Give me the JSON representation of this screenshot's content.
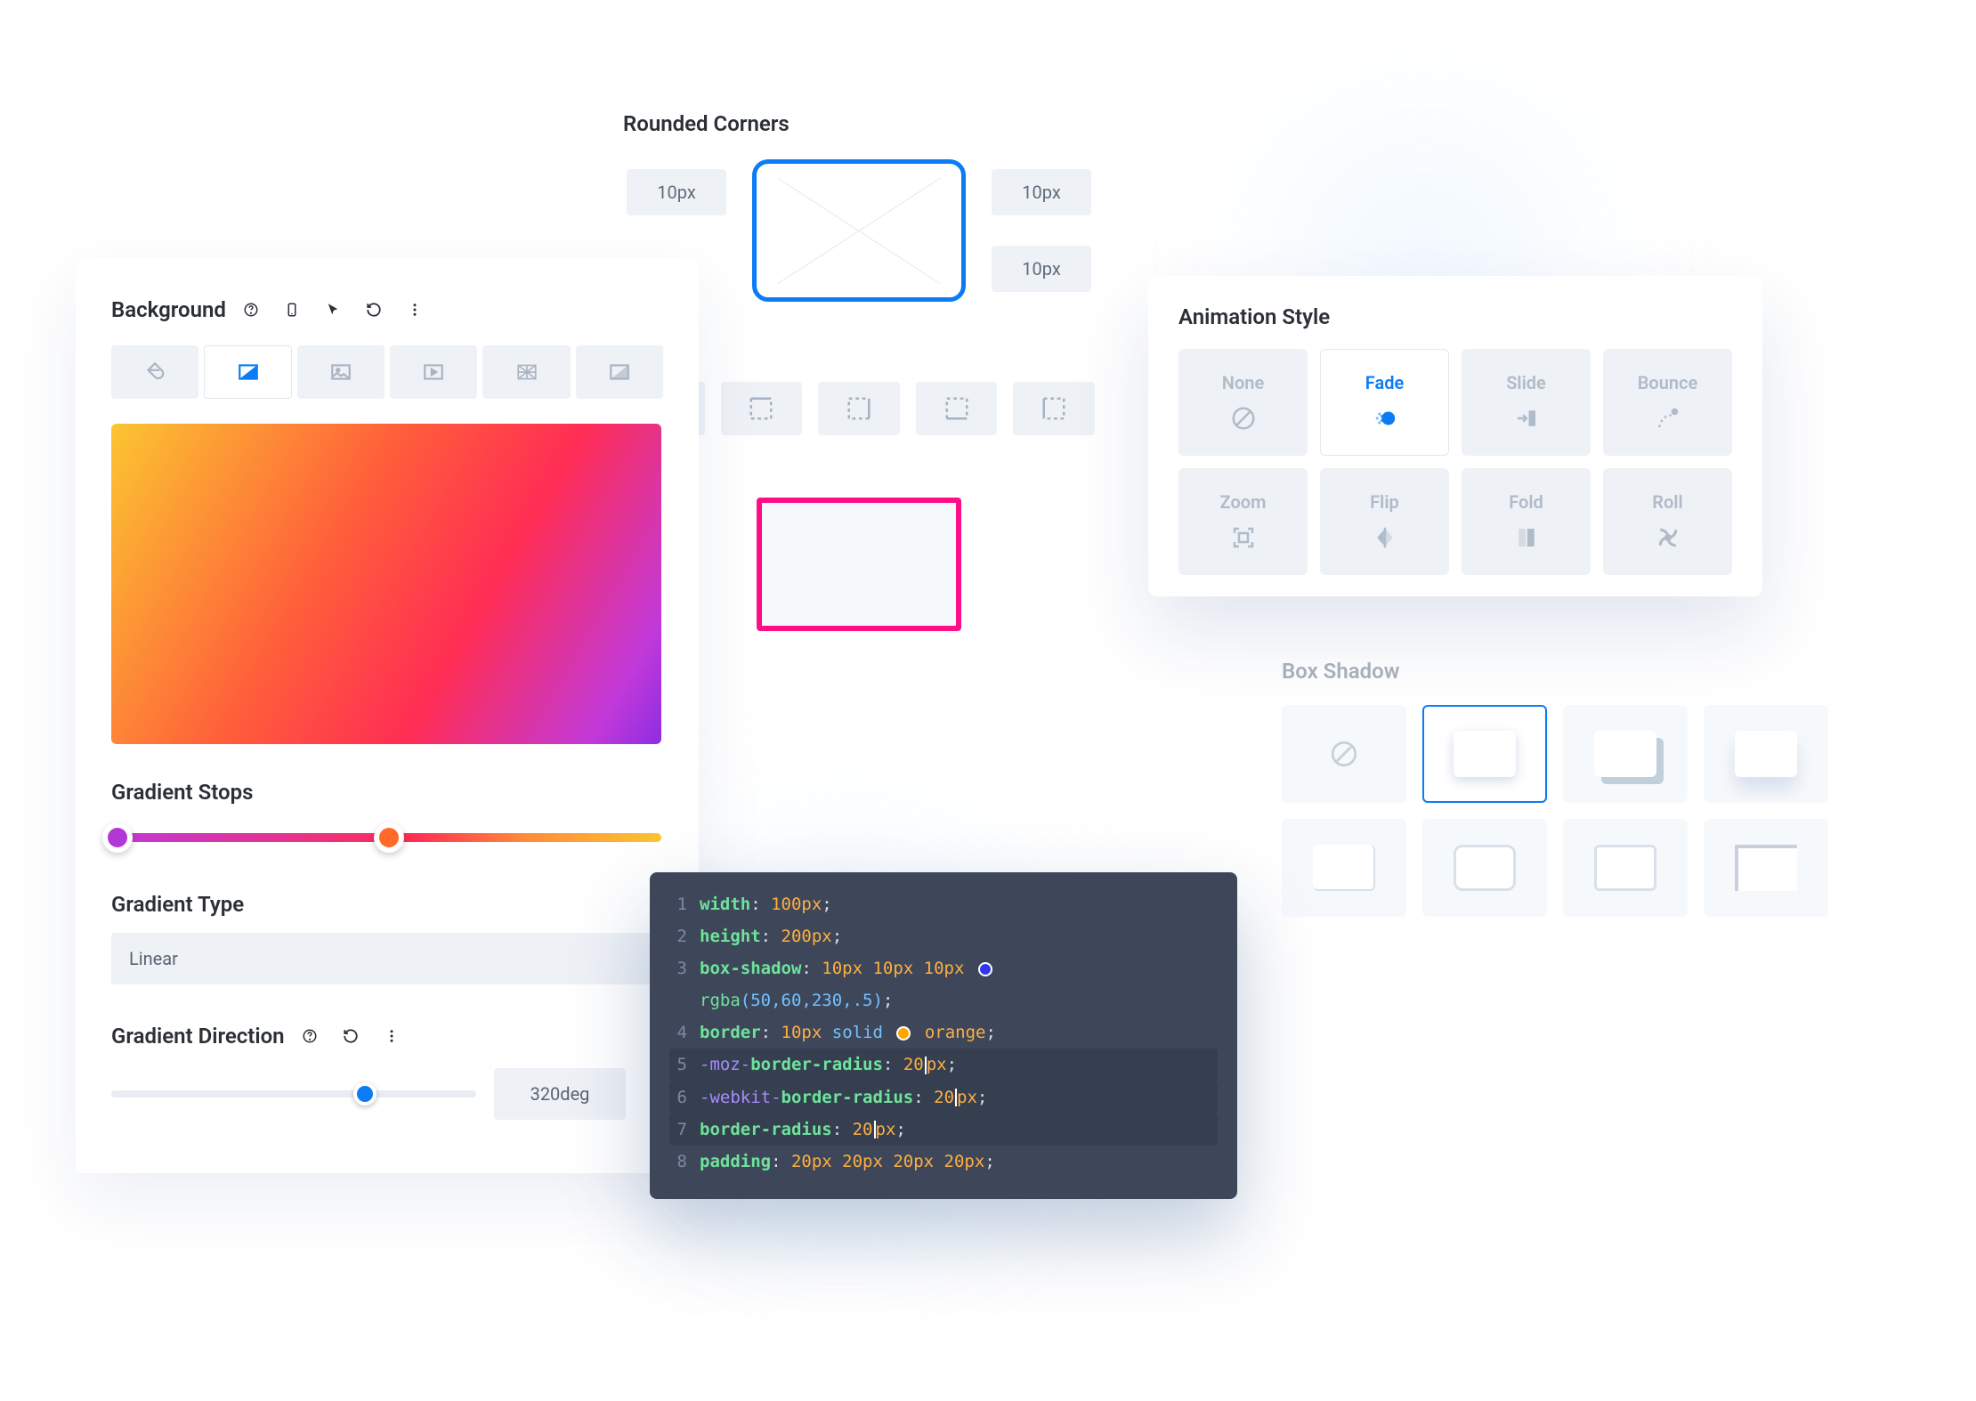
{
  "background_panel": {
    "title": "Background",
    "section_stops": "Gradient Stops",
    "section_type": "Gradient Type",
    "type_value": "Linear",
    "section_direction": "Gradient Direction",
    "direction_value": "320deg"
  },
  "rounded_corners": {
    "title": "Rounded Corners",
    "tl": "10px",
    "tr": "10px",
    "br": "10px"
  },
  "animation": {
    "title": "Animation Style",
    "items": [
      "None",
      "Fade",
      "Slide",
      "Bounce",
      "Zoom",
      "Flip",
      "Fold",
      "Roll"
    ],
    "active": "Fade"
  },
  "box_shadow": {
    "title": "Box Shadow"
  },
  "code": {
    "lines": [
      {
        "n": "1",
        "prop": "width",
        "val": "100px"
      },
      {
        "n": "2",
        "prop": "height",
        "val": "200px"
      },
      {
        "n": "3",
        "prop": "box-shadow",
        "val": "10px 10px 10px",
        "extra_func": "rgba",
        "extra_args": "(50,60,230,.5)"
      },
      {
        "n": "4",
        "prop": "border",
        "val": "10px",
        "kw": "solid",
        "color": "orange"
      },
      {
        "n": "5",
        "pre": "-moz-",
        "prop": "border-radius",
        "val": "20",
        "unit": "px"
      },
      {
        "n": "6",
        "pre": "-webkit-",
        "prop": "border-radius",
        "val": "20",
        "unit": "px"
      },
      {
        "n": "7",
        "prop": "border-radius",
        "val": "20",
        "unit": "px"
      },
      {
        "n": "8",
        "prop": "padding",
        "val": "20px 20px 20px 20px"
      }
    ]
  }
}
